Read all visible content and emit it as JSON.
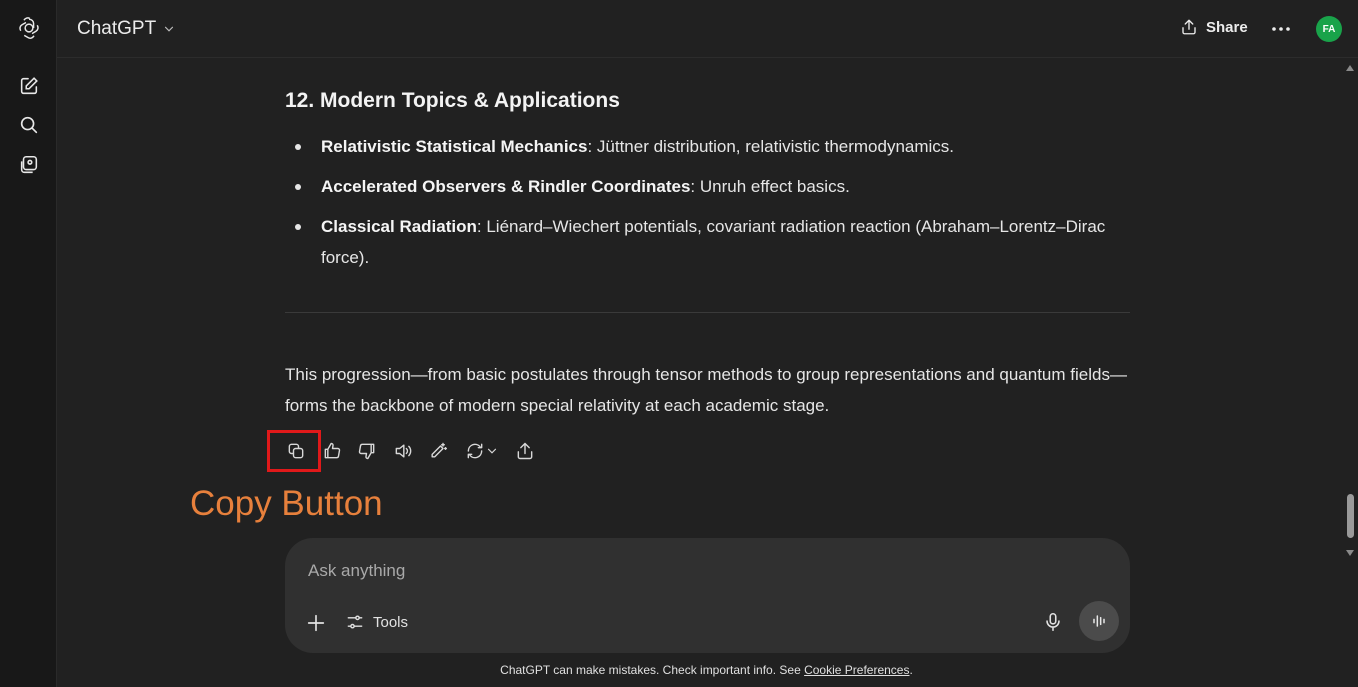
{
  "header": {
    "model_label": "ChatGPT",
    "share_label": "Share",
    "avatar_initials": "FA",
    "avatar_color": "#19a34a"
  },
  "message": {
    "section_heading": "12. Modern Topics & Applications",
    "bullets": [
      {
        "term": "Relativistic Statistical Mechanics",
        "text": ": Jüttner distribution, relativistic thermodynamics."
      },
      {
        "term": "Accelerated Observers & Rindler Coordinates",
        "text": ": Unruh effect basics."
      },
      {
        "term": "Classical Radiation",
        "text": ": Liénard–Wiechert potentials, covariant radiation reaction (Abraham–Lorentz–Dirac force)."
      }
    ],
    "closing_paragraph": "This progression—from basic postulates through tensor methods to group representations and quantum fields—forms the backbone of modern special relativity at each academic stage."
  },
  "actions": {
    "icons": [
      "copy-icon",
      "thumbs-up-icon",
      "thumbs-down-icon",
      "read-aloud-icon",
      "edit-canvas-icon",
      "regenerate-icon",
      "share-icon"
    ]
  },
  "annotation": {
    "label": "Copy Button",
    "color": "#e7803c",
    "box_color": "#e0191a"
  },
  "composer": {
    "placeholder": "Ask anything",
    "tools_label": "Tools"
  },
  "footer": {
    "text": "ChatGPT can make mistakes. Check important info. See ",
    "link": "Cookie Preferences",
    "end": "."
  }
}
